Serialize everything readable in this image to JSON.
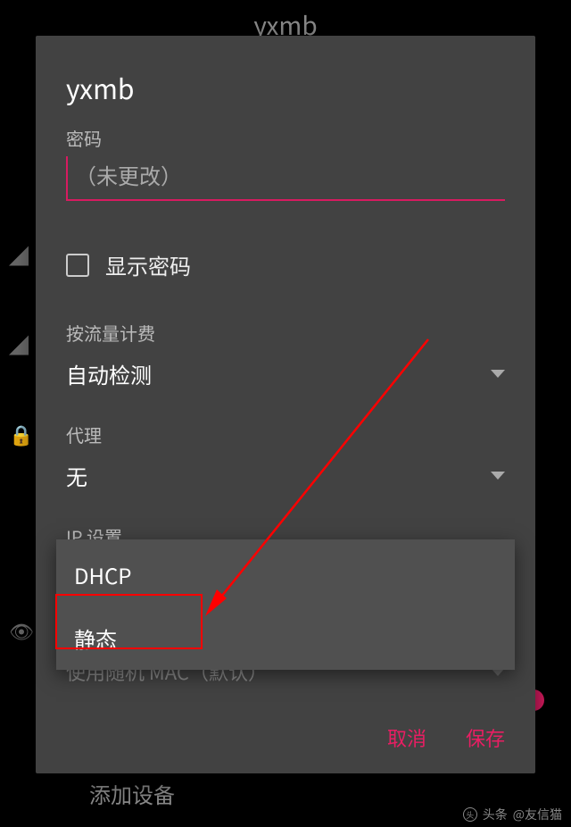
{
  "background": {
    "title": "yxmb",
    "bottom_text": "添加设备"
  },
  "dialog": {
    "title": "yxmb",
    "password": {
      "label": "密码",
      "placeholder": "（未更改）"
    },
    "show_password": {
      "label": "显示密码"
    },
    "metered": {
      "label": "按流量计费",
      "value": "自动检测"
    },
    "proxy": {
      "label": "代理",
      "value": "无"
    },
    "ip_settings": {
      "label": "IP 设置",
      "options": [
        "DHCP",
        "静态"
      ]
    },
    "mac_settings": {
      "value": "使用随机 MAC（默认）"
    },
    "actions": {
      "cancel": "取消",
      "save": "保存"
    }
  },
  "watermark": {
    "brand": "头条",
    "user": "@友信猫"
  }
}
